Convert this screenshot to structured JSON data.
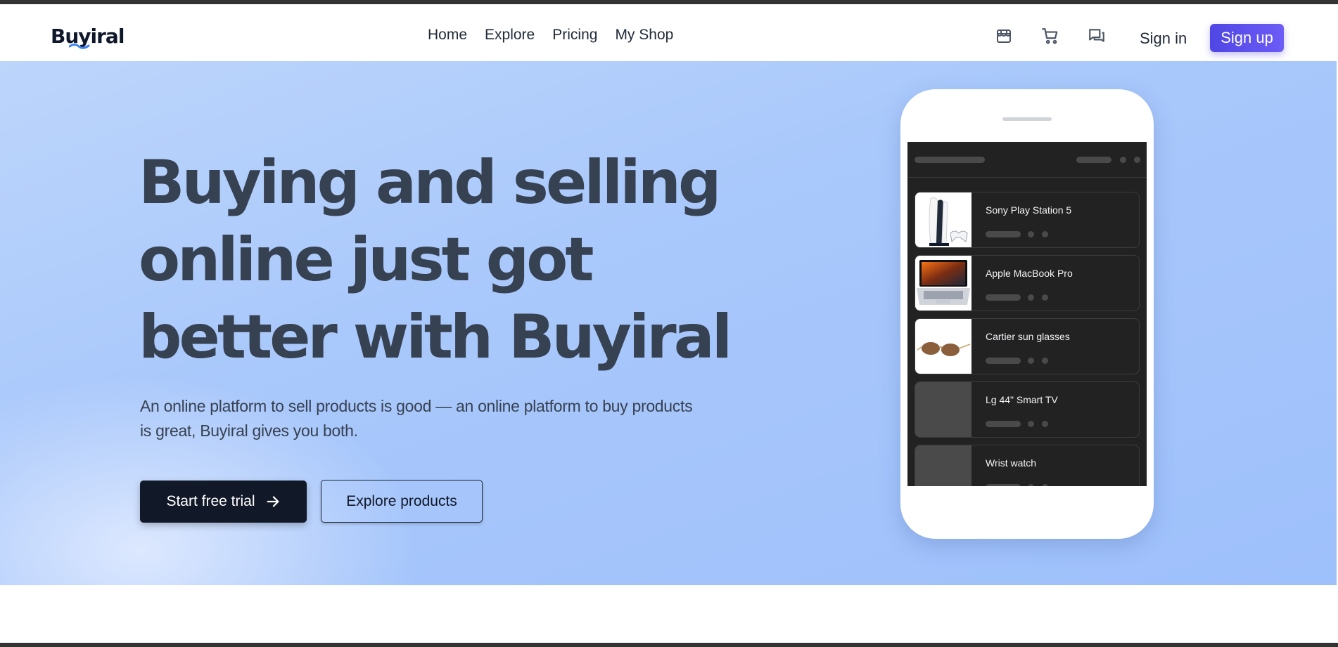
{
  "brand": {
    "name": "Buyiral"
  },
  "nav": {
    "links": [
      "Home",
      "Explore",
      "Pricing",
      "My Shop"
    ],
    "icons": [
      "store-icon",
      "cart-icon",
      "chat-icon"
    ],
    "signin": "Sign in",
    "signup": "Sign up"
  },
  "hero": {
    "title_lines": [
      "Buying and selling",
      "online just got",
      "better with Buyiral"
    ],
    "subtitle_lines": [
      "An online platform to sell products is good — an online platform to buy products",
      "is great, Buyiral gives you both."
    ],
    "primary_cta": "Start free trial",
    "secondary_cta": "Explore products"
  },
  "phone": {
    "products": [
      {
        "name": "Sony Play Station 5",
        "thumb": "ps5"
      },
      {
        "name": "Apple MacBook Pro",
        "thumb": "macbook"
      },
      {
        "name": "Cartier sun glasses",
        "thumb": "sunglasses"
      },
      {
        "name": "Lg 44\" Smart TV",
        "thumb": "placeholder"
      },
      {
        "name": "Wrist watch",
        "thumb": "placeholder"
      }
    ]
  },
  "colors": {
    "accent": "#4f46e5",
    "dark": "#111827",
    "hero_bg": "#a9c8fb"
  }
}
